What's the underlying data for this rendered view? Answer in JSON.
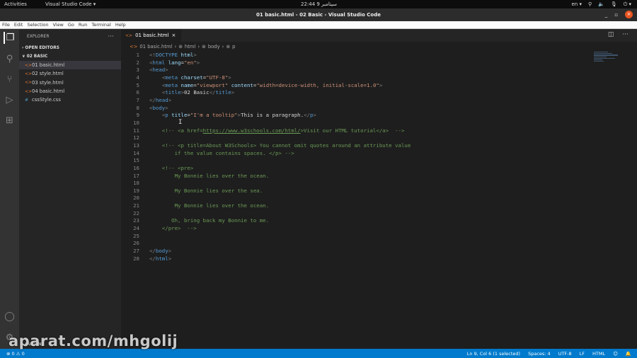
{
  "topbar": {
    "activities": "Activities",
    "app": "Visual Studio Code ▾",
    "clock": "22:44  سپتامبر 9",
    "lang": "en ▾",
    "tray": [
      "⚲",
      "🔈",
      "🎙",
      "⏻ ▾"
    ]
  },
  "window": {
    "title": "01 basic.html - 02 Basic - Visual Studio Code",
    "minimize": "_",
    "restore": "▫",
    "close": "×"
  },
  "menu": [
    "File",
    "Edit",
    "Selection",
    "View",
    "Go",
    "Run",
    "Terminal",
    "Help"
  ],
  "sidebar": {
    "title": "EXPLORER",
    "more": "···",
    "open_editors": "› OPEN EDITORS",
    "folder": "∨ 02 BASIC",
    "files": [
      {
        "name": "01 basic.html",
        "icon": "<>"
      },
      {
        "name": "02 style.html",
        "icon": "<>"
      },
      {
        "name": "03 style.html",
        "icon": "<>"
      },
      {
        "name": "04 basic.html",
        "icon": "<>"
      },
      {
        "name": "cssStyle.css",
        "icon": "#"
      }
    ],
    "outline": "› OUTLINE"
  },
  "editor": {
    "tab": "01 basic.html",
    "tab_close": "×",
    "split": "◫",
    "more": "···",
    "breadcrumbs": [
      "01 basic.html",
      "html",
      "body",
      "p"
    ],
    "lines": [
      [
        [
          "b",
          "<!"
        ],
        [
          "t",
          "DOCTYPE"
        ],
        [
          "a",
          " html"
        ],
        [
          "b",
          ">"
        ]
      ],
      [
        [
          "b",
          "<"
        ],
        [
          "t",
          "html"
        ],
        [
          "a",
          " lang"
        ],
        [
          "x",
          "="
        ],
        [
          "s",
          "\"en\""
        ],
        [
          "b",
          ">"
        ]
      ],
      [
        [
          "b",
          "<"
        ],
        [
          "t",
          "head"
        ],
        [
          "b",
          ">"
        ]
      ],
      [
        [
          "x",
          "    "
        ],
        [
          "b",
          "<"
        ],
        [
          "t",
          "meta"
        ],
        [
          "a",
          " charset"
        ],
        [
          "x",
          "="
        ],
        [
          "s",
          "\"UTF-8\""
        ],
        [
          "b",
          ">"
        ]
      ],
      [
        [
          "x",
          "    "
        ],
        [
          "b",
          "<"
        ],
        [
          "t",
          "meta"
        ],
        [
          "a",
          " name"
        ],
        [
          "x",
          "="
        ],
        [
          "s",
          "\"viewport\""
        ],
        [
          "a",
          " content"
        ],
        [
          "x",
          "="
        ],
        [
          "s",
          "\"width=device-width, initial-scale=1.0\""
        ],
        [
          "b",
          ">"
        ]
      ],
      [
        [
          "x",
          "    "
        ],
        [
          "b",
          "<"
        ],
        [
          "t",
          "title"
        ],
        [
          "b",
          ">"
        ],
        [
          "x",
          "02 Basic"
        ],
        [
          "b",
          "</"
        ],
        [
          "t",
          "title"
        ],
        [
          "b",
          ">"
        ]
      ],
      [
        [
          "b",
          "</"
        ],
        [
          "t",
          "head"
        ],
        [
          "b",
          ">"
        ]
      ],
      [
        [
          "b",
          "<"
        ],
        [
          "t",
          "body"
        ],
        [
          "b",
          ">"
        ]
      ],
      [
        [
          "x",
          "    "
        ],
        [
          "b",
          "<"
        ],
        [
          "t",
          "p"
        ],
        [
          "a",
          " title"
        ],
        [
          "x",
          "="
        ],
        [
          "s",
          "\"I'm a tooltip\""
        ],
        [
          "b",
          ">"
        ],
        [
          "x",
          "This is a paragraph."
        ],
        [
          "b",
          "</"
        ],
        [
          "t",
          "p"
        ],
        [
          "b",
          ">"
        ]
      ],
      [
        [
          "x",
          ""
        ]
      ],
      [
        [
          "c",
          "    <!-- <a href="
        ],
        [
          "u",
          "https://www.w3schools.com/html/"
        ],
        [
          "c",
          ">Visit our HTML tutorial</a>  -->"
        ]
      ],
      [
        [
          "x",
          ""
        ]
      ],
      [
        [
          "c",
          "    <!-- <p title=About W3Schools> You cannot omit quotes around an attribute value"
        ]
      ],
      [
        [
          "c",
          "        if the value contains spaces. </p> -->"
        ]
      ],
      [
        [
          "x",
          ""
        ]
      ],
      [
        [
          "c",
          "    <!-- <pre>"
        ]
      ],
      [
        [
          "c",
          "        My Bonnie lies over the ocean."
        ]
      ],
      [
        [
          "x",
          ""
        ]
      ],
      [
        [
          "c",
          "        My Bonnie lies over the sea."
        ]
      ],
      [
        [
          "x",
          ""
        ]
      ],
      [
        [
          "c",
          "        My Bonnie lies over the ocean."
        ]
      ],
      [
        [
          "x",
          ""
        ]
      ],
      [
        [
          "c",
          "       Oh, bring back my Bonnie to me."
        ]
      ],
      [
        [
          "c",
          "    </pre>  -->"
        ]
      ],
      [
        [
          "x",
          ""
        ]
      ],
      [
        [
          "x",
          ""
        ]
      ],
      [
        [
          "b",
          "</"
        ],
        [
          "t",
          "body"
        ],
        [
          "b",
          ">"
        ]
      ],
      [
        [
          "b",
          "</"
        ],
        [
          "t",
          "html"
        ],
        [
          "b",
          ">"
        ]
      ]
    ]
  },
  "status": {
    "problems": "⊗ 0 ⚠ 0",
    "position": "Ln 9, Col 6 (1 selected)",
    "spaces": "Spaces: 4",
    "encoding": "UTF-8",
    "eol": "LF",
    "language": "HTML",
    "feedback": "☺",
    "bell": "🔔"
  },
  "watermark": "aparat.com/mhgolij"
}
